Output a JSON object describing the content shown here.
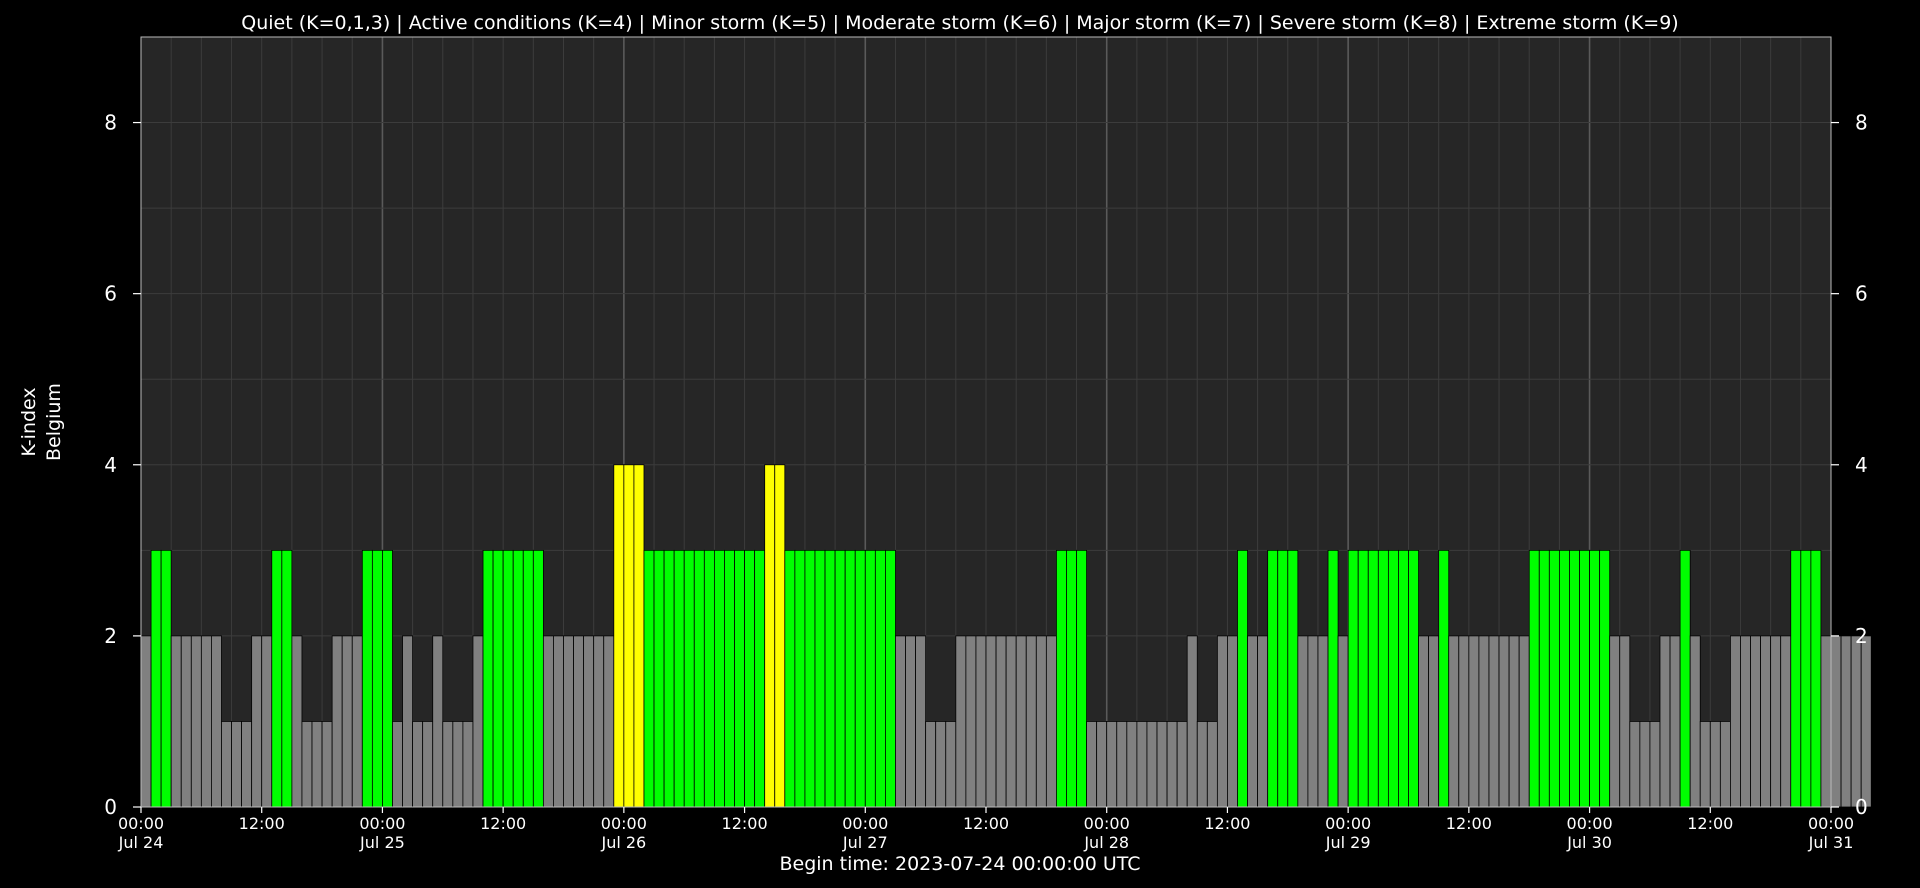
{
  "legend_text": "Quiet (K=0,1,3) | Active conditions (K=4) | Minor storm (K=5) | Moderate storm (K=6) | Major storm (K=7) | Severe storm (K=8) | Extreme storm (K=9)",
  "colors": {
    "background": "#000000",
    "plot_bg": "#262626",
    "grid": "#3c3c3c",
    "day_line": "#5a5a5a",
    "text": "#ffffff",
    "k_low": "#808080",
    "k_3": "#00ff00",
    "k_4": "#ffff00"
  },
  "chart_data": {
    "type": "bar",
    "title": "",
    "xlabel": "Begin time: 2023-07-24 00:00:00 UTC",
    "ylabel": [
      "K-index",
      "Belgium"
    ],
    "ylim": [
      0,
      9
    ],
    "y_ticks": [
      0,
      2,
      4,
      6,
      8
    ],
    "x_range_hours": [
      0,
      168
    ],
    "bar_interval_hours": 1,
    "grid": true,
    "x_ticks": [
      {
        "hour": 0,
        "time": "00:00",
        "date": "Jul 24"
      },
      {
        "hour": 12,
        "time": "12:00",
        "date": ""
      },
      {
        "hour": 24,
        "time": "00:00",
        "date": "Jul 25"
      },
      {
        "hour": 36,
        "time": "12:00",
        "date": ""
      },
      {
        "hour": 48,
        "time": "00:00",
        "date": "Jul 26"
      },
      {
        "hour": 60,
        "time": "12:00",
        "date": ""
      },
      {
        "hour": 72,
        "time": "00:00",
        "date": "Jul 27"
      },
      {
        "hour": 84,
        "time": "12:00",
        "date": ""
      },
      {
        "hour": 96,
        "time": "00:00",
        "date": "Jul 28"
      },
      {
        "hour": 108,
        "time": "12:00",
        "date": ""
      },
      {
        "hour": 120,
        "time": "00:00",
        "date": "Jul 29"
      },
      {
        "hour": 132,
        "time": "12:00",
        "date": ""
      },
      {
        "hour": 144,
        "time": "00:00",
        "date": "Jul 30"
      },
      {
        "hour": 156,
        "time": "12:00",
        "date": ""
      },
      {
        "hour": 168,
        "time": "00:00",
        "date": "Jul 31"
      }
    ],
    "values": [
      2,
      3,
      3,
      2,
      2,
      2,
      2,
      2,
      1,
      1,
      1,
      2,
      2,
      3,
      3,
      2,
      1,
      1,
      1,
      2,
      2,
      2,
      3,
      3,
      3,
      1,
      2,
      1,
      1,
      2,
      1,
      1,
      1,
      2,
      3,
      3,
      3,
      3,
      3,
      3,
      2,
      2,
      2,
      2,
      2,
      2,
      2,
      4,
      4,
      4,
      3,
      3,
      3,
      3,
      3,
      3,
      3,
      3,
      3,
      3,
      3,
      3,
      4,
      4,
      3,
      3,
      3,
      3,
      3,
      3,
      3,
      3,
      3,
      3,
      3,
      2,
      2,
      2,
      1,
      1,
      1,
      2,
      2,
      2,
      2,
      2,
      2,
      2,
      2,
      2,
      2,
      3,
      3,
      3,
      1,
      1,
      1,
      1,
      1,
      1,
      1,
      1,
      1,
      1,
      2,
      1,
      1,
      2,
      2,
      3,
      2,
      2,
      3,
      3,
      3,
      2,
      2,
      2,
      3,
      2,
      3,
      3,
      3,
      3,
      3,
      3,
      3,
      2,
      2,
      3,
      2,
      2,
      2,
      2,
      2,
      2,
      2,
      2,
      3,
      3,
      3,
      3,
      3,
      3,
      3,
      3,
      2,
      2,
      1,
      1,
      1,
      2,
      2,
      3,
      2,
      1,
      1,
      1,
      2,
      2,
      2,
      2,
      2,
      2,
      3,
      3,
      3,
      2,
      2,
      2,
      2,
      2
    ]
  }
}
